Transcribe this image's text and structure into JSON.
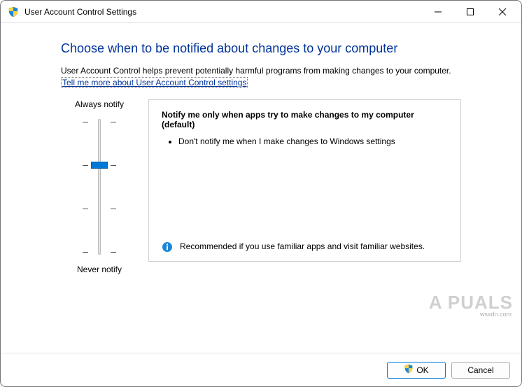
{
  "window": {
    "title": "User Account Control Settings"
  },
  "heading": "Choose when to be notified about changes to your computer",
  "subtext": "User Account Control helps prevent potentially harmful programs from making changes to your computer.",
  "helpLink": "Tell me more about User Account Control settings",
  "slider": {
    "topLabel": "Always notify",
    "bottomLabel": "Never notify",
    "positions": 4,
    "current": 1
  },
  "description": {
    "title": "Notify me only when apps try to make changes to my computer (default)",
    "bullets": [
      "Don't notify me when I make changes to Windows settings"
    ],
    "recommendation": "Recommended if you use familiar apps and visit familiar websites."
  },
  "buttons": {
    "ok": "OK",
    "cancel": "Cancel"
  },
  "watermark": {
    "main": "A  PUALS",
    "sub": "wsxdn.com"
  }
}
